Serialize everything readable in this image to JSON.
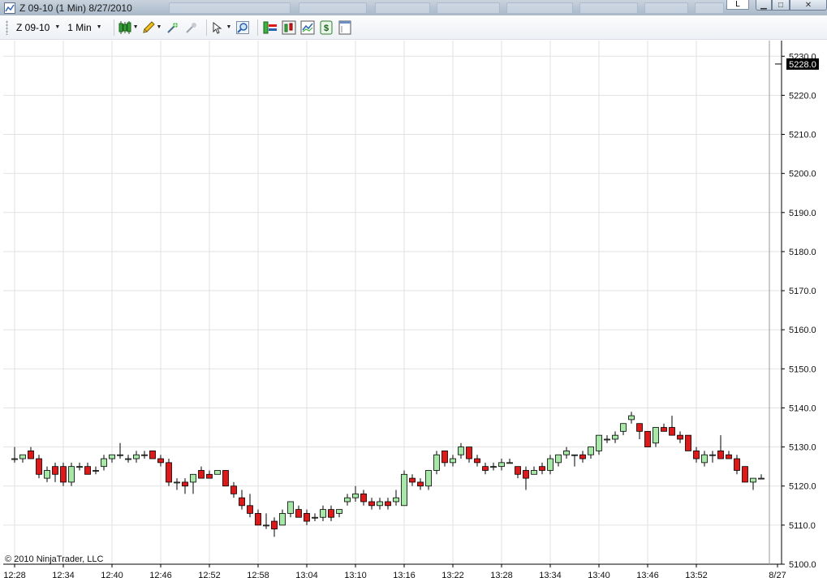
{
  "window": {
    "title": "Z 09-10 (1 Min)  8/27/2010",
    "top_tab": "L",
    "min_glyph": "▁",
    "max_glyph": "□",
    "close_glyph": "✕"
  },
  "toolbar": {
    "instrument": "Z 09-10",
    "interval": "1 Min",
    "icons": [
      "candlestick-style-icon",
      "pencil-draw-icon",
      "add-indicator-icon",
      "strategy-icon",
      "pointer-icon",
      "zoom-icon",
      "order-bars-icon",
      "chart-trader-icon",
      "chart-properties-icon",
      "dollar-icon",
      "data-box-icon"
    ]
  },
  "colors": {
    "up": "#a6e8a6",
    "down": "#e01818",
    "grid": "#e2e2e2",
    "axis": "#000000",
    "price_marker_bg": "#000000",
    "price_marker_fg": "#ffffff"
  },
  "chart_data": {
    "type": "candlestick",
    "ylim": [
      5100,
      5234
    ],
    "yticks": [
      5100,
      5110,
      5120,
      5130,
      5140,
      5150,
      5160,
      5170,
      5180,
      5190,
      5200,
      5210,
      5220,
      5230
    ],
    "ytick_labels": [
      "5100.0",
      "5110.0",
      "5120.0",
      "5130.0",
      "5140.0",
      "5150.0",
      "5160.0",
      "5170.0",
      "5180.0",
      "5190.0",
      "5200.0",
      "5210.0",
      "5220.0",
      "5230.0"
    ],
    "xticks": [
      "12:28",
      "12:34",
      "12:40",
      "12:46",
      "12:52",
      "12:58",
      "13:04",
      "13:10",
      "13:16",
      "13:22",
      "13:28",
      "13:34",
      "13:40",
      "13:46",
      "13:52",
      "8/27"
    ],
    "last_price_label": "5228.0",
    "last_price": 5228,
    "copyright": "© 2010 NinjaTrader, LLC",
    "candles": [
      [
        5127,
        5130,
        5126,
        5127
      ],
      [
        5127,
        5128,
        5126,
        5128
      ],
      [
        5129,
        5130,
        5127,
        5127
      ],
      [
        5127,
        5128,
        5122,
        5123
      ],
      [
        5122,
        5125,
        5121,
        5124
      ],
      [
        5125,
        5126,
        5121,
        5123
      ],
      [
        5125,
        5126,
        5120,
        5121
      ],
      [
        5121,
        5126,
        5120,
        5125
      ],
      [
        5125,
        5126,
        5124,
        5125
      ],
      [
        5125,
        5126,
        5123,
        5123
      ],
      [
        5124,
        5125,
        5123,
        5124
      ],
      [
        5125,
        5128,
        5124,
        5127
      ],
      [
        5127,
        5128,
        5126,
        5128
      ],
      [
        5128,
        5131,
        5127,
        5128
      ],
      [
        5127,
        5128,
        5126,
        5127
      ],
      [
        5127,
        5129,
        5126,
        5128
      ],
      [
        5128,
        5129,
        5127,
        5128
      ],
      [
        5129,
        5129,
        5127,
        5127
      ],
      [
        5127,
        5128,
        5125,
        5126
      ],
      [
        5126,
        5127,
        5120,
        5121
      ],
      [
        5121,
        5122,
        5119,
        5121
      ],
      [
        5121,
        5122,
        5118,
        5120
      ],
      [
        5121,
        5123,
        5118,
        5123
      ],
      [
        5124,
        5125,
        5122,
        5122
      ],
      [
        5123,
        5124,
        5122,
        5122
      ],
      [
        5123,
        5124,
        5123,
        5124
      ],
      [
        5124,
        5124,
        5120,
        5120
      ],
      [
        5120,
        5121,
        5117,
        5118
      ],
      [
        5117,
        5119,
        5114,
        5115
      ],
      [
        5115,
        5118,
        5112,
        5113
      ],
      [
        5113,
        5114,
        5110,
        5110
      ],
      [
        5110,
        5113,
        5109,
        5110
      ],
      [
        5111,
        5112,
        5107,
        5109
      ],
      [
        5110,
        5114,
        5110,
        5113
      ],
      [
        5113,
        5116,
        5112,
        5116
      ],
      [
        5114,
        5115,
        5112,
        5112
      ],
      [
        5113,
        5114,
        5110,
        5111
      ],
      [
        5112,
        5113,
        5111,
        5112
      ],
      [
        5112,
        5115,
        5111,
        5114
      ],
      [
        5114,
        5115,
        5111,
        5112
      ],
      [
        5113,
        5114,
        5112,
        5114
      ],
      [
        5116,
        5118,
        5115,
        5117
      ],
      [
        5117,
        5120,
        5116,
        5118
      ],
      [
        5118,
        5119,
        5115,
        5116
      ],
      [
        5116,
        5117,
        5114,
        5115
      ],
      [
        5115,
        5117,
        5114,
        5116
      ],
      [
        5116,
        5117,
        5114,
        5115
      ],
      [
        5116,
        5119,
        5115,
        5117
      ],
      [
        5115,
        5124,
        5115,
        5123
      ],
      [
        5122,
        5123,
        5120,
        5121
      ],
      [
        5121,
        5122,
        5119,
        5120
      ],
      [
        5120,
        5124,
        5119,
        5124
      ],
      [
        5124,
        5129,
        5123,
        5128
      ],
      [
        5129,
        5129,
        5125,
        5126
      ],
      [
        5126,
        5128,
        5125,
        5127
      ],
      [
        5128,
        5131,
        5127,
        5130
      ],
      [
        5130,
        5130,
        5126,
        5127
      ],
      [
        5127,
        5128,
        5125,
        5126
      ],
      [
        5125,
        5126,
        5123,
        5124
      ],
      [
        5125,
        5126,
        5124,
        5125
      ],
      [
        5125,
        5127,
        5124,
        5126
      ],
      [
        5126,
        5127,
        5126,
        5126
      ],
      [
        5125,
        5125,
        5122,
        5123
      ],
      [
        5124,
        5125,
        5119,
        5122
      ],
      [
        5123,
        5125,
        5123,
        5124
      ],
      [
        5125,
        5126,
        5123,
        5124
      ],
      [
        5124,
        5128,
        5123,
        5127
      ],
      [
        5126,
        5128,
        5125,
        5128
      ],
      [
        5128,
        5130,
        5127,
        5129
      ],
      [
        5128,
        5128,
        5125,
        5128
      ],
      [
        5128,
        5129,
        5126,
        5127
      ],
      [
        5128,
        5130,
        5127,
        5130
      ],
      [
        5129,
        5133,
        5128,
        5133
      ],
      [
        5132,
        5133,
        5131,
        5132
      ],
      [
        5132,
        5134,
        5131,
        5133
      ],
      [
        5134,
        5136,
        5133,
        5136
      ],
      [
        5137,
        5139,
        5136,
        5138
      ],
      [
        5136,
        5136,
        5132,
        5134
      ],
      [
        5134,
        5134,
        5130,
        5130
      ],
      [
        5131,
        5135,
        5130,
        5135
      ],
      [
        5135,
        5136,
        5134,
        5134
      ],
      [
        5135,
        5138,
        5133,
        5133
      ],
      [
        5133,
        5134,
        5131,
        5132
      ],
      [
        5133,
        5133,
        5129,
        5129
      ],
      [
        5129,
        5130,
        5126,
        5127
      ],
      [
        5126,
        5129,
        5125,
        5128
      ],
      [
        5128,
        5129,
        5126,
        5128
      ],
      [
        5129,
        5133,
        5127,
        5127
      ],
      [
        5128,
        5129,
        5127,
        5127
      ],
      [
        5127,
        5128,
        5123,
        5124
      ],
      [
        5125,
        5125,
        5121,
        5121
      ],
      [
        5121,
        5122,
        5119,
        5122
      ],
      [
        5122,
        5123,
        5122,
        5122
      ]
    ]
  }
}
